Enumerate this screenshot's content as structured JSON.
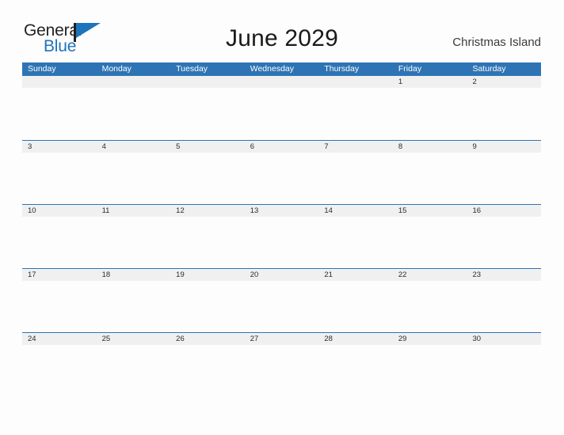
{
  "brand": {
    "name_part1": "General",
    "name_part2": "Blue",
    "flag_icon": "triangle-flag-icon",
    "colors": {
      "text_dark": "#231f20",
      "blue": "#1d74bd"
    }
  },
  "header": {
    "title": "June 2029",
    "location": "Christmas Island"
  },
  "calendar": {
    "colors": {
      "header_blue": "#2e74b5",
      "row_band_gray": "#f0f0f0",
      "page_background": "#fdfdfd",
      "day_number_text": "#2b2b2b",
      "weekday_text": "#ffffff"
    },
    "weekdays": [
      "Sunday",
      "Monday",
      "Tuesday",
      "Wednesday",
      "Thursday",
      "Friday",
      "Saturday"
    ],
    "weeks": [
      {
        "days": [
          "",
          "",
          "",
          "",
          "",
          "1",
          "2"
        ]
      },
      {
        "days": [
          "3",
          "4",
          "5",
          "6",
          "7",
          "8",
          "9"
        ]
      },
      {
        "days": [
          "10",
          "11",
          "12",
          "13",
          "14",
          "15",
          "16"
        ]
      },
      {
        "days": [
          "17",
          "18",
          "19",
          "20",
          "21",
          "22",
          "23"
        ]
      },
      {
        "days": [
          "24",
          "25",
          "26",
          "27",
          "28",
          "29",
          "30"
        ]
      }
    ]
  }
}
